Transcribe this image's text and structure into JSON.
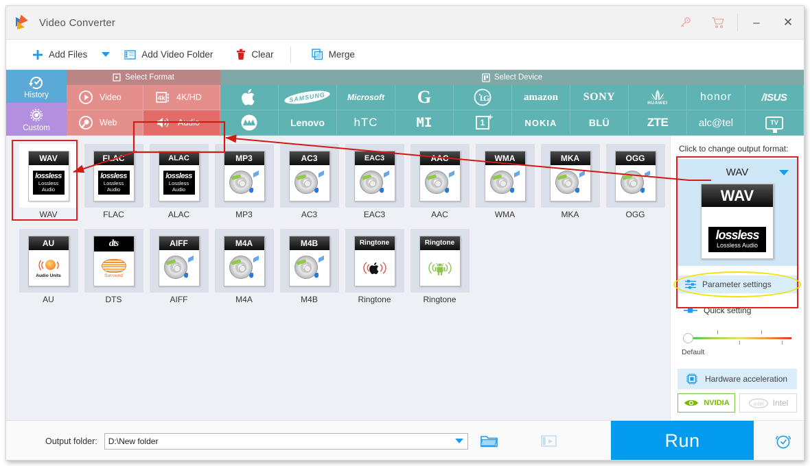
{
  "window": {
    "title": "Video Converter",
    "icons": {
      "key": "key-icon",
      "cart": "cart-icon",
      "minimize": "minimize-icon",
      "close": "close-icon"
    }
  },
  "toolbar": {
    "add_files": "Add Files",
    "add_video_folder": "Add Video Folder",
    "clear": "Clear",
    "merge": "Merge"
  },
  "sidebar": {
    "items": [
      {
        "label": "History",
        "color": "#5aa9d6"
      },
      {
        "label": "Custom",
        "color": "#b38fe0"
      }
    ]
  },
  "select_format": {
    "header": "Select Format",
    "items": [
      {
        "label": "Video",
        "selected": false
      },
      {
        "label": "4K/HD",
        "selected": false
      },
      {
        "label": "Web",
        "selected": false
      },
      {
        "label": "Audio",
        "selected": true
      }
    ]
  },
  "select_device": {
    "header": "Select Device",
    "items": [
      "Apple",
      "SAMSUNG",
      "Microsoft",
      "Google",
      "LG",
      "amazon",
      "SONY",
      "HUAWEI",
      "honor",
      "ASUS",
      "Motorola",
      "Lenovo",
      "HTC",
      "MI",
      "OnePlus",
      "NOKIA",
      "BLU",
      "ZTE",
      "alcatel",
      "TV"
    ]
  },
  "formats": {
    "row1": [
      {
        "label": "WAV",
        "badge": "WAV",
        "kind": "lossless",
        "selected": true
      },
      {
        "label": "FLAC",
        "badge": "FLAC",
        "kind": "lossless",
        "selected": false
      },
      {
        "label": "ALAC",
        "badge": "ALAC",
        "kind": "lossless",
        "selected": false
      },
      {
        "label": "MP3",
        "badge": "MP3",
        "kind": "disc",
        "selected": false
      },
      {
        "label": "AC3",
        "badge": "AC3",
        "kind": "disc",
        "selected": false
      },
      {
        "label": "EAC3",
        "badge": "EAC3",
        "kind": "disc",
        "selected": false
      },
      {
        "label": "AAC",
        "badge": "AAC",
        "kind": "disc",
        "selected": false
      },
      {
        "label": "WMA",
        "badge": "WMA",
        "kind": "disc",
        "selected": false
      },
      {
        "label": "MKA",
        "badge": "MKA",
        "kind": "disc",
        "selected": false
      },
      {
        "label": "OGG",
        "badge": "OGG",
        "kind": "disc",
        "selected": false
      }
    ],
    "row2": [
      {
        "label": "AU",
        "badge": "AU",
        "kind": "au",
        "sub": "Audio Units",
        "selected": false
      },
      {
        "label": "DTS",
        "badge": "dts",
        "kind": "dts",
        "sub": "Surround",
        "selected": false
      },
      {
        "label": "AIFF",
        "badge": "AIFF",
        "kind": "disc",
        "selected": false
      },
      {
        "label": "M4A",
        "badge": "M4A",
        "kind": "disc",
        "selected": false
      },
      {
        "label": "M4B",
        "badge": "M4B",
        "kind": "disc",
        "selected": false
      },
      {
        "label": "Ringtone",
        "badge": "Ringtone",
        "kind": "ring-apple",
        "selected": false
      },
      {
        "label": "Ringtone",
        "badge": "Ringtone",
        "kind": "ring-android",
        "selected": false
      }
    ],
    "lossless_badge_big": "lossless",
    "lossless_caption_line1": "Lossless",
    "lossless_caption_line2": "Audio"
  },
  "right_panel": {
    "title": "Click to change output format:",
    "output_format": "WAV",
    "preview_badge": "WAV",
    "preview_lossless": "lossless",
    "preview_caption": "Lossless Audio",
    "parameter_settings": "Parameter settings",
    "quick_setting": "Quick setting",
    "slider_label": "Default",
    "hardware_acceleration": "Hardware acceleration",
    "gpu_nvidia": "NVIDIA",
    "gpu_intel": "Intel"
  },
  "bottom": {
    "output_folder_label": "Output folder:",
    "output_folder_value": "D:\\New folder",
    "run_label": "Run"
  },
  "colors": {
    "accent_blue": "#039bef",
    "format_red": "#e58f8d",
    "format_red_selected": "#e36c68",
    "device_teal": "#5fb3b3",
    "annotation_red": "#d11a14",
    "annotation_yellow": "#f2e400"
  }
}
